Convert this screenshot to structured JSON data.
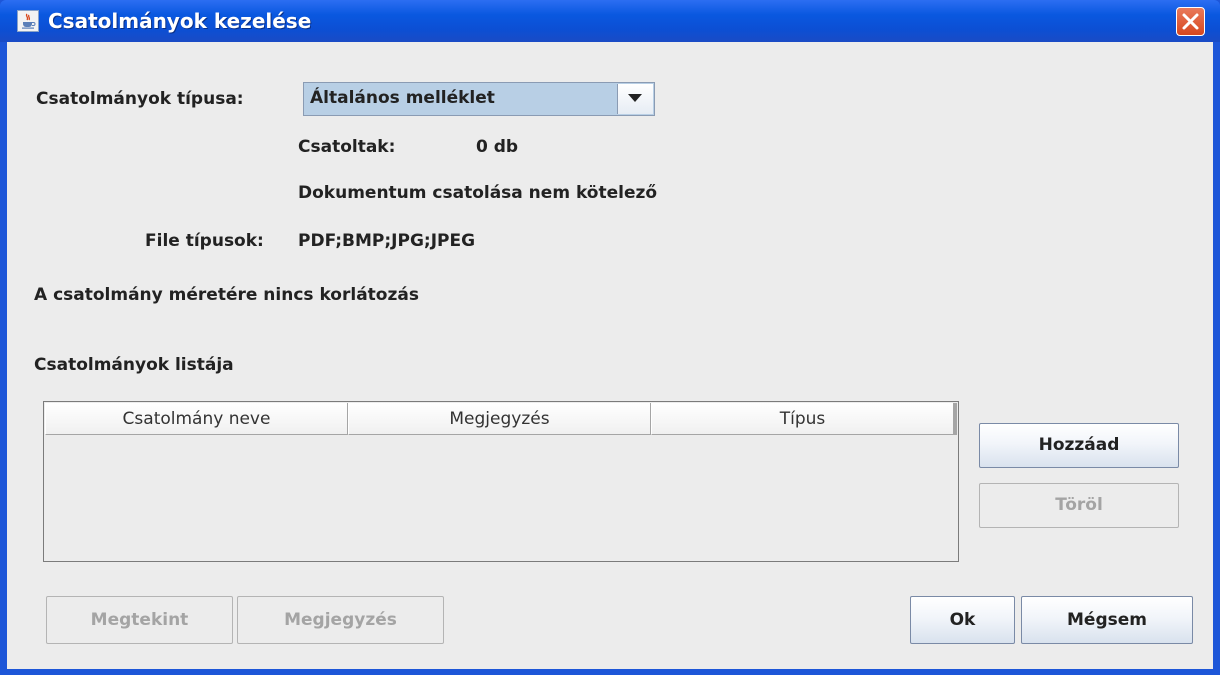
{
  "window": {
    "title": "Csatolmányok kezelése"
  },
  "form": {
    "type_label": "Csatolmányok típusa:",
    "type_selected": "Általános melléklet",
    "attached_label": "Csatoltak:",
    "attached_value": "0 db",
    "required_note": "Dokumentum csatolása nem kötelező",
    "file_types_label": "File típusok:",
    "file_types_value": "PDF;BMP;JPG;JPEG",
    "size_note": "A csatolmány méretére nincs korlátozás"
  },
  "list": {
    "title": "Csatolmányok listája",
    "columns": [
      "Csatolmány neve",
      "Megjegyzés",
      "Típus"
    ],
    "rows": []
  },
  "buttons": {
    "add": "Hozzáad",
    "delete": "Töröl",
    "view": "Megtekint",
    "note": "Megjegyzés",
    "ok": "Ok",
    "cancel": "Mégsem"
  },
  "icons": {
    "app": "java-cup-icon",
    "close": "close-icon",
    "dropdown": "chevron-down-icon"
  }
}
